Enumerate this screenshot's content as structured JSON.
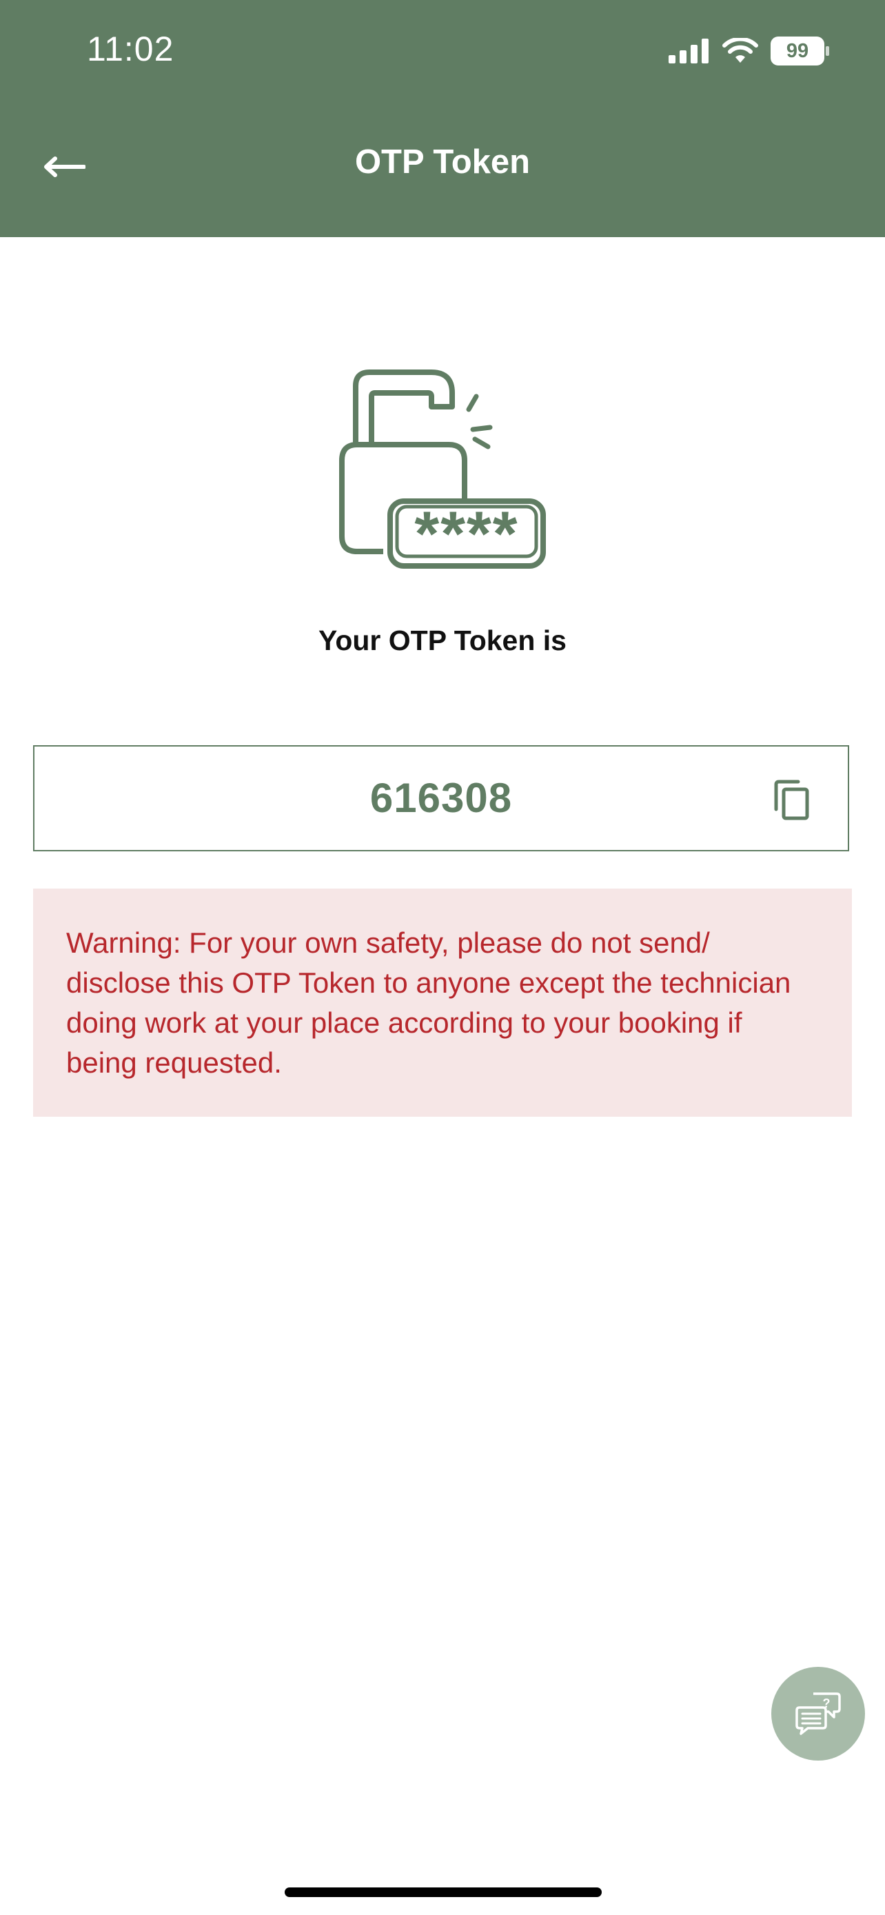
{
  "status_bar": {
    "time": "11:02",
    "battery": "99"
  },
  "header": {
    "title": "OTP Token",
    "back_icon": "arrow-left-icon"
  },
  "main": {
    "illustration_icon": "unlocked-padlock-password-icon",
    "illustration_mask": "****",
    "caption": "Your OTP Token is",
    "token": "616308",
    "copy_icon": "copy-icon",
    "warning": "Warning: For your own safety, please do not send/ disclose this OTP Token to anyone except the technician doing work at your place according to your booking if being requested."
  },
  "help_button": {
    "icon": "help-chat-icon"
  },
  "colors": {
    "brand_green": "#607d63",
    "warning_bg": "#f6e6e6",
    "warning_text": "#b7272c",
    "fab_bg": "#a7bba9"
  }
}
